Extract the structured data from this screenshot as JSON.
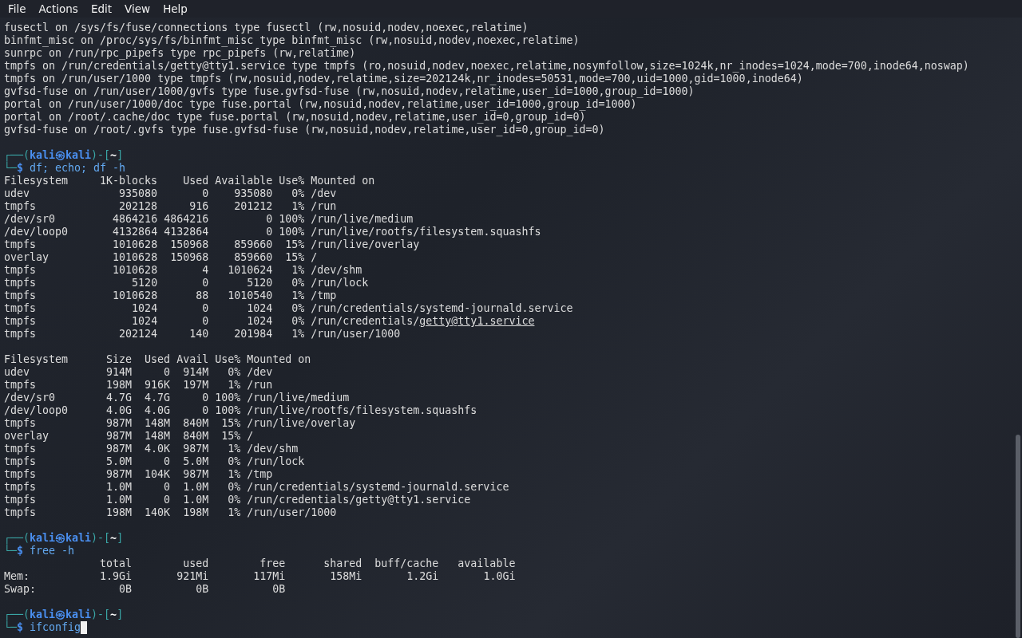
{
  "menu": [
    "File",
    "Actions",
    "Edit",
    "View",
    "Help"
  ],
  "blocks": [
    {
      "kind": "output",
      "text": "fusectl on /sys/fs/fuse/connections type fusectl (rw,nosuid,nodev,noexec,relatime)"
    },
    {
      "kind": "output",
      "text": "binfmt_misc on /proc/sys/fs/binfmt_misc type binfmt_misc (rw,nosuid,nodev,noexec,relatime)"
    },
    {
      "kind": "output",
      "text": "sunrpc on /run/rpc_pipefs type rpc_pipefs (rw,relatime)"
    },
    {
      "kind": "output",
      "text": "tmpfs on /run/credentials/getty@tty1.service type tmpfs (ro,nosuid,nodev,noexec,relatime,nosymfollow,size=1024k,nr_inodes=1024,mode=700,inode64,noswap)"
    },
    {
      "kind": "output",
      "text": "tmpfs on /run/user/1000 type tmpfs (rw,nosuid,nodev,relatime,size=202124k,nr_inodes=50531,mode=700,uid=1000,gid=1000,inode64)"
    },
    {
      "kind": "output",
      "text": "gvfsd-fuse on /run/user/1000/gvfs type fuse.gvfsd-fuse (rw,nosuid,nodev,relatime,user_id=1000,group_id=1000)"
    },
    {
      "kind": "output",
      "text": "portal on /run/user/1000/doc type fuse.portal (rw,nosuid,nodev,relatime,user_id=1000,group_id=1000)"
    },
    {
      "kind": "output",
      "text": "portal on /root/.cache/doc type fuse.portal (rw,nosuid,nodev,relatime,user_id=0,group_id=0)"
    },
    {
      "kind": "output",
      "text": "gvfsd-fuse on /root/.gvfs type fuse.gvfsd-fuse (rw,nosuid,nodev,relatime,user_id=0,group_id=0)"
    },
    {
      "kind": "blank"
    },
    {
      "kind": "prompt",
      "open": "┌──(",
      "user": "kali㉿kali",
      "mid": ")-[",
      "dir": "~",
      "close": "]"
    },
    {
      "kind": "command",
      "sign": "└─$",
      "text": "df; echo; df -h",
      "cursor": false
    },
    {
      "kind": "df",
      "header": [
        "Filesystem",
        "1K-blocks",
        "Used",
        "Available",
        "Use%",
        "Mounted on"
      ],
      "rows": [
        {
          "cells": [
            "udev",
            "935080",
            "0",
            "935080",
            "0%",
            "/dev"
          ]
        },
        {
          "cells": [
            "tmpfs",
            "202128",
            "916",
            "201212",
            "1%",
            "/run"
          ]
        },
        {
          "cells": [
            "/dev/sr0",
            "4864216",
            "4864216",
            "0",
            "100%",
            "/run/live/medium"
          ]
        },
        {
          "cells": [
            "/dev/loop0",
            "4132864",
            "4132864",
            "0",
            "100%",
            "/run/live/rootfs/filesystem.squashfs"
          ]
        },
        {
          "cells": [
            "tmpfs",
            "1010628",
            "150968",
            "859660",
            "15%",
            "/run/live/overlay"
          ]
        },
        {
          "cells": [
            "overlay",
            "1010628",
            "150968",
            "859660",
            "15%",
            "/"
          ]
        },
        {
          "cells": [
            "tmpfs",
            "1010628",
            "4",
            "1010624",
            "1%",
            "/dev/shm"
          ]
        },
        {
          "cells": [
            "tmpfs",
            "5120",
            "0",
            "5120",
            "0%",
            "/run/lock"
          ]
        },
        {
          "cells": [
            "tmpfs",
            "1010628",
            "88",
            "1010540",
            "1%",
            "/tmp"
          ]
        },
        {
          "cells": [
            "tmpfs",
            "1024",
            "0",
            "1024",
            "0%",
            "/run/credentials/systemd-journald.service"
          ]
        },
        {
          "cells": [
            "tmpfs",
            "1024",
            "0",
            "1024",
            "0%",
            "/run/credentials/"
          ],
          "link": "getty@tty1.service"
        },
        {
          "cells": [
            "tmpfs",
            "202124",
            "140",
            "201984",
            "1%",
            "/run/user/1000"
          ]
        }
      ]
    },
    {
      "kind": "blank"
    },
    {
      "kind": "df_h",
      "header": [
        "Filesystem",
        "Size",
        "Used",
        "Avail",
        "Use%",
        "Mounted on"
      ],
      "rows": [
        {
          "cells": [
            "udev",
            "914M",
            "0",
            "914M",
            "0%",
            "/dev"
          ]
        },
        {
          "cells": [
            "tmpfs",
            "198M",
            "916K",
            "197M",
            "1%",
            "/run"
          ]
        },
        {
          "cells": [
            "/dev/sr0",
            "4.7G",
            "4.7G",
            "0",
            "100%",
            "/run/live/medium"
          ]
        },
        {
          "cells": [
            "/dev/loop0",
            "4.0G",
            "4.0G",
            "0",
            "100%",
            "/run/live/rootfs/filesystem.squashfs"
          ]
        },
        {
          "cells": [
            "tmpfs",
            "987M",
            "148M",
            "840M",
            "15%",
            "/run/live/overlay"
          ]
        },
        {
          "cells": [
            "overlay",
            "987M",
            "148M",
            "840M",
            "15%",
            "/"
          ]
        },
        {
          "cells": [
            "tmpfs",
            "987M",
            "4.0K",
            "987M",
            "1%",
            "/dev/shm"
          ]
        },
        {
          "cells": [
            "tmpfs",
            "5.0M",
            "0",
            "5.0M",
            "0%",
            "/run/lock"
          ]
        },
        {
          "cells": [
            "tmpfs",
            "987M",
            "104K",
            "987M",
            "1%",
            "/tmp"
          ]
        },
        {
          "cells": [
            "tmpfs",
            "1.0M",
            "0",
            "1.0M",
            "0%",
            "/run/credentials/systemd-journald.service"
          ]
        },
        {
          "cells": [
            "tmpfs",
            "1.0M",
            "0",
            "1.0M",
            "0%",
            "/run/credentials/getty@tty1.service"
          ]
        },
        {
          "cells": [
            "tmpfs",
            "198M",
            "140K",
            "198M",
            "1%",
            "/run/user/1000"
          ]
        }
      ]
    },
    {
      "kind": "blank"
    },
    {
      "kind": "prompt",
      "open": "┌──(",
      "user": "kali㉿kali",
      "mid": ")-[",
      "dir": "~",
      "close": "]"
    },
    {
      "kind": "command",
      "sign": "└─$",
      "text": "free -h",
      "cursor": false
    },
    {
      "kind": "free",
      "header": [
        "total",
        "used",
        "free",
        "shared",
        "buff/cache",
        "available"
      ],
      "rows": [
        {
          "cells": [
            "Mem:",
            "1.9Gi",
            "921Mi",
            "117Mi",
            "158Mi",
            "1.2Gi",
            "1.0Gi"
          ]
        },
        {
          "cells": [
            "Swap:",
            "0B",
            "0B",
            "0B"
          ]
        }
      ]
    },
    {
      "kind": "blank"
    },
    {
      "kind": "prompt",
      "open": "┌──(",
      "user": "kali㉿kali",
      "mid": ")-[",
      "dir": "~",
      "close": "]"
    },
    {
      "kind": "command",
      "sign": "└─$",
      "text": "ifconfig",
      "cursor": true
    }
  ]
}
